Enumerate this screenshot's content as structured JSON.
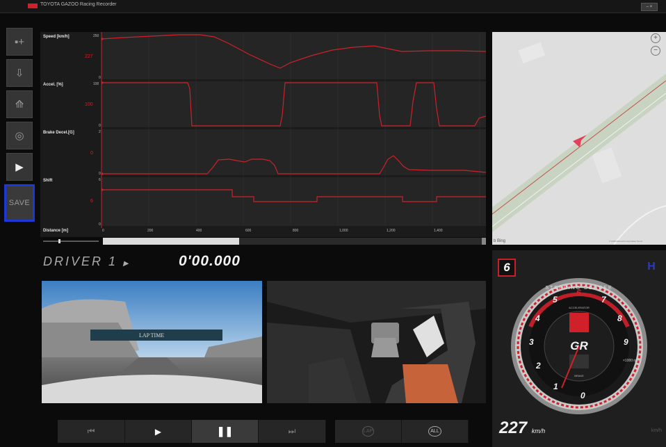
{
  "titlebar": {
    "title": "TOYOTA GAZOO Racing  Recorder",
    "window_controls": "– ×"
  },
  "sidebar": {
    "items": [
      {
        "name": "import-data-button",
        "glyph": "▪+"
      },
      {
        "name": "export-data-button",
        "glyph": "⇩"
      },
      {
        "name": "course-button",
        "glyph": "⟰"
      },
      {
        "name": "lap-button",
        "glyph": "◎"
      },
      {
        "name": "play-button",
        "glyph": "▶"
      }
    ],
    "save_label": "SAVE"
  },
  "charts": {
    "channels": [
      {
        "label": "Speed [km/h]",
        "max": "250",
        "min": "0",
        "value": "227"
      },
      {
        "label": "Accel. [%]",
        "max": "100",
        "min": "0",
        "value": "100"
      },
      {
        "label": "Brake Decel.[G]",
        "max": "2",
        "min": "0",
        "value": "0"
      },
      {
        "label": "Shift",
        "max": "6",
        "min": "0",
        "value": "6"
      }
    ],
    "distance_label": "Distance [m]",
    "distance_ticks": [
      "0",
      "200",
      "400",
      "600",
      "800",
      "1,000",
      "1,200",
      "1,400"
    ],
    "line_color": "#d0202a"
  },
  "map": {
    "zoom_in": "+",
    "zoom_out": "−",
    "provider": "b Bing",
    "attribution": "© 2019 Microsoft Corporation  Terms"
  },
  "driver": {
    "label": "DRIVER  1",
    "arrow": "▶",
    "lap_time": "0'00.000"
  },
  "controls": {
    "skip_back": "⏮",
    "play": "▶",
    "pause": "❚❚",
    "skip_fwd": "⏭",
    "lap_btn": "LAP",
    "all_btn": "ALL"
  },
  "gauge": {
    "gear": "6",
    "hpattern_icon": "H",
    "title": "STEERING DEGREE",
    "accelerator_label": "ACCELERATOR",
    "brake_label": "BRAKE",
    "logo_text": "GR",
    "rpm_unit": "×1000\nrpm",
    "rpm_ticks": [
      "0",
      "1",
      "2",
      "3",
      "4",
      "5",
      "6",
      "7",
      "8",
      "9"
    ],
    "speed": "227",
    "speed_unit": "km/h",
    "accent": "#d0202a"
  }
}
